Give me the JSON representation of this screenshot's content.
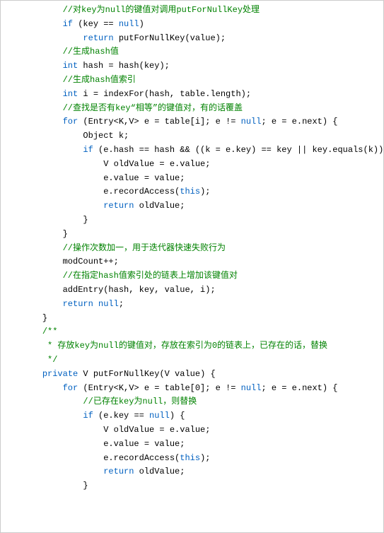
{
  "code": {
    "lines": [
      {
        "indent": 2,
        "segs": [
          {
            "t": "cmt",
            "v": "//对key为null的键值对调用putForNullKey处理"
          }
        ]
      },
      {
        "indent": 2,
        "segs": [
          {
            "t": "kw",
            "v": "if"
          },
          {
            "t": "",
            "v": " (key == "
          },
          {
            "t": "kw",
            "v": "null"
          },
          {
            "t": "",
            "v": ")"
          }
        ]
      },
      {
        "indent": 3,
        "segs": [
          {
            "t": "kw",
            "v": "return"
          },
          {
            "t": "",
            "v": " putForNullKey(value);"
          }
        ]
      },
      {
        "indent": 0,
        "segs": [
          {
            "t": "",
            "v": ""
          }
        ]
      },
      {
        "indent": 2,
        "segs": [
          {
            "t": "cmt",
            "v": "//生成hash值"
          }
        ]
      },
      {
        "indent": 2,
        "segs": [
          {
            "t": "kw",
            "v": "int"
          },
          {
            "t": "",
            "v": " hash = hash(key);"
          }
        ]
      },
      {
        "indent": 0,
        "segs": [
          {
            "t": "",
            "v": ""
          }
        ]
      },
      {
        "indent": 2,
        "segs": [
          {
            "t": "cmt",
            "v": "//生成hash值索引"
          }
        ]
      },
      {
        "indent": 2,
        "segs": [
          {
            "t": "kw",
            "v": "int"
          },
          {
            "t": "",
            "v": " i = indexFor(hash, table.length);"
          }
        ]
      },
      {
        "indent": 0,
        "segs": [
          {
            "t": "",
            "v": ""
          }
        ]
      },
      {
        "indent": 2,
        "segs": [
          {
            "t": "cmt",
            "v": "//查找是否有key“相等”的键值对，有的话覆盖"
          }
        ]
      },
      {
        "indent": 2,
        "segs": [
          {
            "t": "kw",
            "v": "for"
          },
          {
            "t": "",
            "v": " (Entry<K,V> e = table[i]; e != "
          },
          {
            "t": "kw",
            "v": "null"
          },
          {
            "t": "",
            "v": "; e = e.next) {"
          }
        ]
      },
      {
        "indent": 3,
        "segs": [
          {
            "t": "",
            "v": "Object k;"
          }
        ]
      },
      {
        "indent": 3,
        "segs": [
          {
            "t": "kw",
            "v": "if"
          },
          {
            "t": "",
            "v": " (e.hash == hash && ((k = e.key) == key || key.equals(k))) {"
          }
        ]
      },
      {
        "indent": 4,
        "segs": [
          {
            "t": "",
            "v": "V oldValue = e.value;"
          }
        ]
      },
      {
        "indent": 4,
        "segs": [
          {
            "t": "",
            "v": "e.value = value;"
          }
        ]
      },
      {
        "indent": 4,
        "segs": [
          {
            "t": "",
            "v": "e.recordAccess("
          },
          {
            "t": "kw",
            "v": "this"
          },
          {
            "t": "",
            "v": ");"
          }
        ]
      },
      {
        "indent": 4,
        "segs": [
          {
            "t": "kw",
            "v": "return"
          },
          {
            "t": "",
            "v": " oldValue;"
          }
        ]
      },
      {
        "indent": 3,
        "segs": [
          {
            "t": "",
            "v": "}"
          }
        ]
      },
      {
        "indent": 2,
        "segs": [
          {
            "t": "",
            "v": "}"
          }
        ]
      },
      {
        "indent": 0,
        "segs": [
          {
            "t": "",
            "v": ""
          }
        ]
      },
      {
        "indent": 2,
        "segs": [
          {
            "t": "cmt",
            "v": "//操作次数加一，用于迭代器快速失败行为"
          }
        ]
      },
      {
        "indent": 2,
        "segs": [
          {
            "t": "",
            "v": "modCount++;"
          }
        ]
      },
      {
        "indent": 0,
        "segs": [
          {
            "t": "",
            "v": ""
          }
        ]
      },
      {
        "indent": 2,
        "segs": [
          {
            "t": "cmt",
            "v": "//在指定hash值索引处的链表上增加该键值对"
          }
        ]
      },
      {
        "indent": 2,
        "segs": [
          {
            "t": "",
            "v": "addEntry(hash, key, value, i);"
          }
        ]
      },
      {
        "indent": 2,
        "segs": [
          {
            "t": "kw",
            "v": "return"
          },
          {
            "t": "",
            "v": " "
          },
          {
            "t": "kw",
            "v": "null"
          },
          {
            "t": "",
            "v": ";"
          }
        ]
      },
      {
        "indent": 1,
        "segs": [
          {
            "t": "",
            "v": "}"
          }
        ]
      },
      {
        "indent": 0,
        "segs": [
          {
            "t": "",
            "v": ""
          }
        ]
      },
      {
        "indent": 1,
        "segs": [
          {
            "t": "cmt",
            "v": "/**"
          }
        ]
      },
      {
        "indent": 1,
        "segs": [
          {
            "t": "cmt",
            "v": " * 存放key为null的键值对，存放在索引为0的链表上，已存在的话，替换"
          }
        ]
      },
      {
        "indent": 1,
        "segs": [
          {
            "t": "cmt",
            "v": " */"
          }
        ]
      },
      {
        "indent": 1,
        "segs": [
          {
            "t": "kw",
            "v": "private"
          },
          {
            "t": "",
            "v": " V putForNullKey(V value) {"
          }
        ]
      },
      {
        "indent": 2,
        "segs": [
          {
            "t": "kw",
            "v": "for"
          },
          {
            "t": "",
            "v": " (Entry<K,V> e = table[0]; e != "
          },
          {
            "t": "kw",
            "v": "null"
          },
          {
            "t": "",
            "v": "; e = e.next) {"
          }
        ]
      },
      {
        "indent": 3,
        "segs": [
          {
            "t": "cmt",
            "v": "//已存在key为null，则替换"
          }
        ]
      },
      {
        "indent": 3,
        "segs": [
          {
            "t": "kw",
            "v": "if"
          },
          {
            "t": "",
            "v": " (e.key == "
          },
          {
            "t": "kw",
            "v": "null"
          },
          {
            "t": "",
            "v": ") {"
          }
        ]
      },
      {
        "indent": 4,
        "segs": [
          {
            "t": "",
            "v": "V oldValue = e.value;"
          }
        ]
      },
      {
        "indent": 4,
        "segs": [
          {
            "t": "",
            "v": "e.value = value;"
          }
        ]
      },
      {
        "indent": 4,
        "segs": [
          {
            "t": "",
            "v": "e.recordAccess("
          },
          {
            "t": "kw",
            "v": "this"
          },
          {
            "t": "",
            "v": ");"
          }
        ]
      },
      {
        "indent": 4,
        "segs": [
          {
            "t": "kw",
            "v": "return"
          },
          {
            "t": "",
            "v": " oldValue;"
          }
        ]
      },
      {
        "indent": 3,
        "segs": [
          {
            "t": "",
            "v": "}"
          }
        ]
      }
    ]
  }
}
